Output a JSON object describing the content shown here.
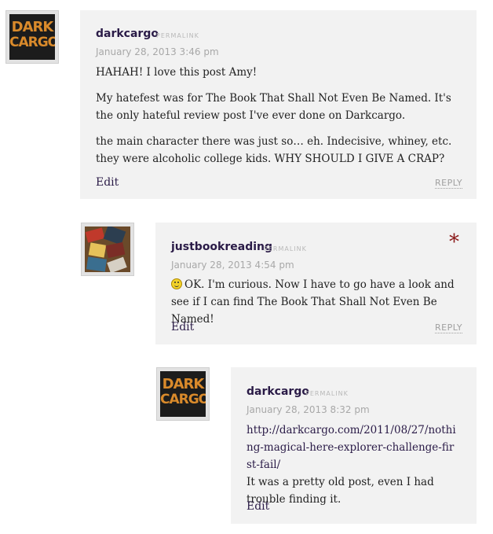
{
  "comments": [
    {
      "author": "darkcargo",
      "permalink": "PERMALINK",
      "date": "January 28, 2013 3:46 pm",
      "paragraphs": [
        "HAHAH! I love this post Amy!",
        "My hatefest was for The Book That Shall Not Even Be Named. It's the only hateful review post I've ever done on Darkcargo.",
        "the main character there was just so… eh. Indecisive, whiney, etc. they were alcoholic college kids. WHY SHOULD I GIVE A CRAP?"
      ],
      "edit": "Edit",
      "reply": "REPLY",
      "avatar_text": [
        "DARK",
        "CARGO"
      ]
    },
    {
      "author": "justbookreading",
      "permalink": "PERMALINK",
      "date": "January 28, 2013 4:54 pm",
      "text": "OK. I'm curious. Now I have to go have a look and see if I can find The Book That Shall Not Even Be Named!",
      "edit": "Edit",
      "reply": "REPLY",
      "marker": "*"
    },
    {
      "author": "darkcargo",
      "permalink": "PERMALINK",
      "date": "January 28, 2013 8:32 pm",
      "link": "http://darkcargo.com/2011/08/27/nothing-magical-here-explorer-challenge-first-fail/",
      "text": "It was a pretty old post, even I had trouble finding it.",
      "edit": "Edit",
      "avatar_text": [
        "DARK",
        "CARGO"
      ]
    }
  ]
}
